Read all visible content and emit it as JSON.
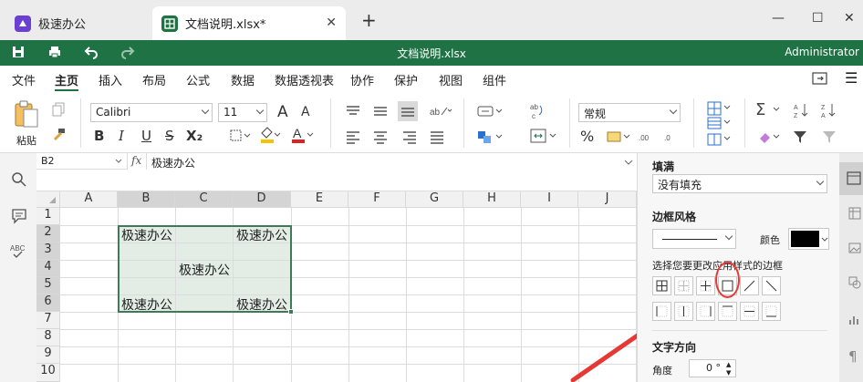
{
  "tabs": [
    {
      "label": "极速办公",
      "active": false
    },
    {
      "label": "文档说明.xlsx*",
      "active": true
    }
  ],
  "window": {
    "minimize": "—",
    "maximize": "☐",
    "close": "✕",
    "new_tab": "+"
  },
  "titlebar": {
    "title": "文档说明.xlsx",
    "user": "Administrator"
  },
  "menu": [
    "文件",
    "主页",
    "插入",
    "布局",
    "公式",
    "数据",
    "数据透视表",
    "协作",
    "保护",
    "视图",
    "组件"
  ],
  "ribbon": {
    "paste_label": "粘贴",
    "font_name": "Calibri",
    "font_size": "11",
    "number_format": "常规",
    "bold": "B",
    "italic": "I",
    "underline": "U",
    "strike": "S",
    "subscript": "X₂",
    "percent": "%",
    "grow": "A",
    "shrink": "A"
  },
  "formula_bar": {
    "cell_ref": "B2",
    "fx": "fx",
    "content": "极速办公"
  },
  "grid": {
    "columns": [
      "A",
      "B",
      "C",
      "D",
      "E",
      "F",
      "G",
      "H",
      "I",
      "J"
    ],
    "rows": [
      "1",
      "2",
      "3",
      "4",
      "5",
      "6",
      "7",
      "8",
      "9",
      "10"
    ],
    "cells": {
      "B2": "极速办公",
      "D2": "极速办公",
      "C4": "极速办公",
      "B6": "极速办公",
      "D6": "极速办公"
    }
  },
  "panel": {
    "fill_title": "填满",
    "fill_value": "没有填充",
    "border_style_title": "边框风格",
    "color_label": "颜色",
    "border_hint": "选择您要更改应用样式的边框",
    "text_dir_title": "文字方向",
    "angle_label": "角度",
    "angle_value": "0 °"
  },
  "colors": {
    "accent": "#1f7244",
    "annotation": "#e53935",
    "selection": "#e3ede6"
  }
}
